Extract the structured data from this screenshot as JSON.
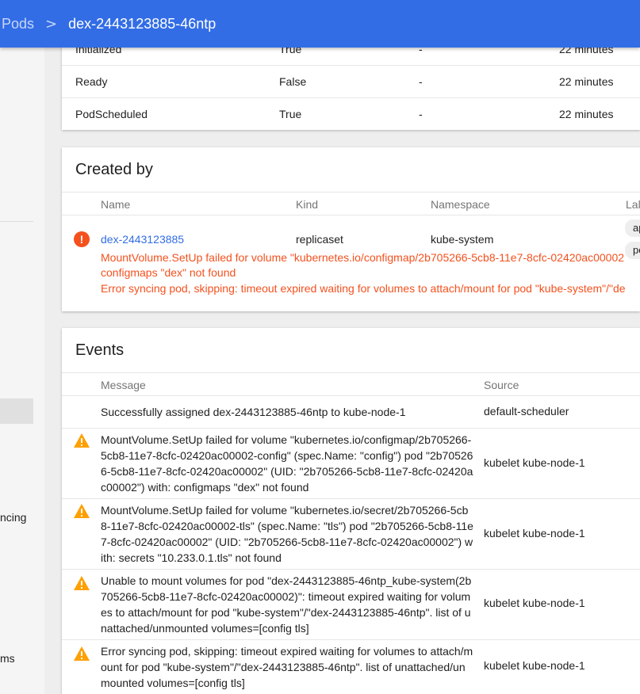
{
  "header": {
    "parent": "Pods",
    "separator": ">",
    "current": "dex-2443123885-46ntp"
  },
  "sidenav": {
    "partial_items": [
      "ncing",
      "ms"
    ]
  },
  "conditions": {
    "rows": [
      {
        "type": "Initialized",
        "status": "True",
        "reason": "-",
        "age": "22 minutes"
      },
      {
        "type": "Ready",
        "status": "False",
        "reason": "-",
        "age": "22 minutes"
      },
      {
        "type": "PodScheduled",
        "status": "True",
        "reason": "-",
        "age": "22 minutes"
      }
    ]
  },
  "created_by": {
    "title": "Created by",
    "columns": {
      "name": "Name",
      "kind": "Kind",
      "namespace": "Namespace",
      "labels": "Lal"
    },
    "row": {
      "name": "dex-2443123885",
      "kind": "replicaset",
      "namespace": "kube-system",
      "labels": [
        "ap",
        "po"
      ],
      "errors": [
        "MountVolume.SetUp failed for volume \"kubernetes.io/configmap/2b705266-5cb8-11e7-8cfc-02420ac00002",
        "configmaps \"dex\" not found",
        "Error syncing pod, skipping: timeout expired waiting for volumes to attach/mount for pod \"kube-system\"/\"de"
      ]
    }
  },
  "events": {
    "title": "Events",
    "columns": {
      "message": "Message",
      "source": "Source"
    },
    "rows": [
      {
        "warning": false,
        "message": "Successfully assigned dex-2443123885-46ntp to kube-node-1",
        "source": "default-scheduler"
      },
      {
        "warning": true,
        "message": "MountVolume.SetUp failed for volume \"kubernetes.io/configmap/2b705266-5cb8-11e7-8cfc-02420ac00002-config\" (spec.Name: \"config\") pod \"2b705266-5cb8-11e7-8cfc-02420ac00002\" (UID: \"2b705266-5cb8-11e7-8cfc-02420ac00002\") with: configmaps \"dex\" not found",
        "source": "kubelet kube-node-1"
      },
      {
        "warning": true,
        "message": "MountVolume.SetUp failed for volume \"kubernetes.io/secret/2b705266-5cb8-11e7-8cfc-02420ac00002-tls\" (spec.Name: \"tls\") pod \"2b705266-5cb8-11e7-8cfc-02420ac00002\" (UID: \"2b705266-5cb8-11e7-8cfc-02420ac00002\") with: secrets \"10.233.0.1.tls\" not found",
        "source": "kubelet kube-node-1"
      },
      {
        "warning": true,
        "message": "Unable to mount volumes for pod \"dex-2443123885-46ntp_kube-system(2b705266-5cb8-11e7-8cfc-02420ac00002)\": timeout expired waiting for volumes to attach/mount for pod \"kube-system\"/\"dex-2443123885-46ntp\". list of unattached/unmounted volumes=[config tls]",
        "source": "kubelet kube-node-1"
      },
      {
        "warning": true,
        "message": "Error syncing pod, skipping: timeout expired waiting for volumes to attach/mount for pod \"kube-system\"/\"dex-2443123885-46ntp\". list of unattached/unmounted volumes=[config tls]",
        "source": "kubelet kube-node-1"
      }
    ]
  },
  "colors": {
    "primary": "#326de6",
    "error": "#f4511e",
    "warning": "#ffa000"
  },
  "icons": {
    "error": "error-icon",
    "warning": "warning-icon"
  }
}
